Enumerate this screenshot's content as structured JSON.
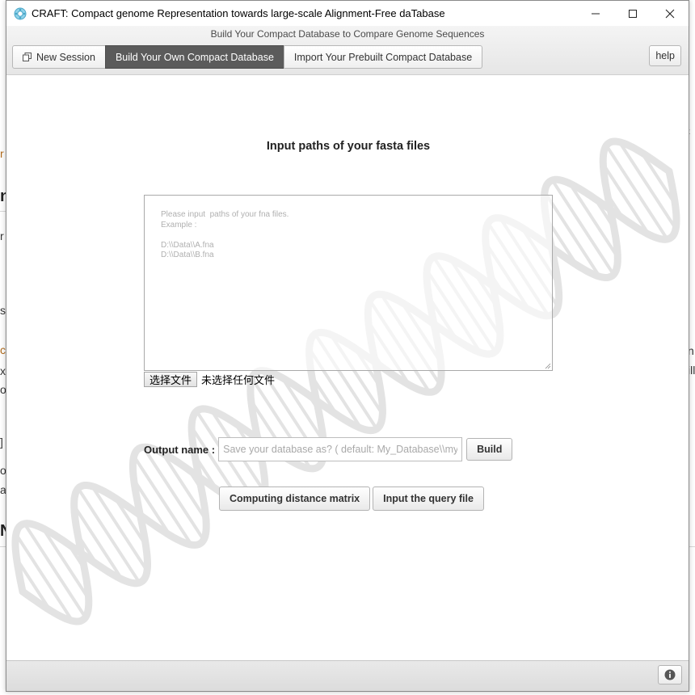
{
  "window": {
    "title": "CRAFT: Compact genome Representation towards large-scale Alignment-Free daTabase",
    "controls": {
      "minimize": "—",
      "maximize": "☐",
      "close": "✕"
    }
  },
  "header": {
    "subtitle": "Build Your Compact Database to Compare Genome Sequences",
    "tabs": [
      {
        "label": "New Session",
        "icon": "restore-window-icon",
        "active": false
      },
      {
        "label": "Build Your Own Compact Database",
        "active": true
      },
      {
        "label": "Import Your Prebuilt Compact Database",
        "active": false
      }
    ],
    "help_label": "help"
  },
  "main": {
    "heading": "Input paths of your fasta files",
    "paths_placeholder_lines": [
      "Please input  paths of your fna files.",
      "Example :",
      "",
      "D:\\\\Data\\\\A.fna",
      "D:\\\\Data\\\\B.fna"
    ],
    "file_button_label": "选择文件",
    "file_status": "未选择任何文件",
    "output_label": "Output name :",
    "output_placeholder": "Save your database as? ( default: My_Database\\\\my_",
    "build_label": "Build",
    "compute_label": "Computing distance matrix",
    "query_label": "Input the query file"
  },
  "footer": {
    "info_icon": "info-icon"
  },
  "background_fragments": [
    "r",
    "n",
    "r",
    "s",
    "c",
    "xt",
    "o",
    "]",
    "o",
    "a",
    "N",
    "n",
    "ill",
    "t"
  ],
  "colors": {
    "active_tab": "#5b5b5b",
    "dna_watermark": "#e3e3e3"
  }
}
